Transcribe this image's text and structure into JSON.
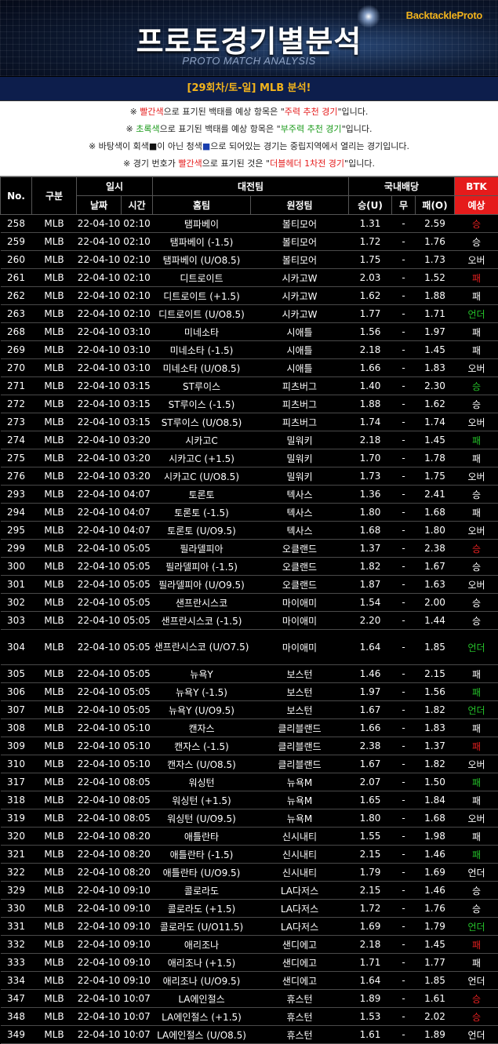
{
  "banner": {
    "brand": "BacktackleProto",
    "title": "프로토경기별분석",
    "subtitle": "PROTO MATCH ANALYSIS"
  },
  "round_title": "[29회차/토-일] MLB 분석!",
  "notes": [
    {
      "segments": [
        [
          "※ ",
          ""
        ],
        [
          "빨간색",
          "red"
        ],
        [
          "으로 표기된 백태를 예상 항목은 \"",
          ""
        ],
        [
          "주력 추천 경기",
          "red"
        ],
        [
          "\"입니다.",
          ""
        ]
      ]
    },
    {
      "segments": [
        [
          "※ ",
          ""
        ],
        [
          "초록색",
          "green"
        ],
        [
          "으로 표기된 백태를 예상 항목은 \"",
          ""
        ],
        [
          "부주력 추천 경기",
          "green"
        ],
        [
          "\"입니다.",
          ""
        ]
      ]
    },
    {
      "segments": [
        [
          "※ 바탕색이 회색",
          ""
        ],
        [
          "■",
          "sq"
        ],
        [
          "이 아닌 청색",
          ""
        ],
        [
          "■",
          "bsq"
        ],
        [
          "으로 되어있는 경기는 중립지역에서 열리는 경기입니다.",
          ""
        ]
      ]
    },
    {
      "segments": [
        [
          "※ 경기 번호가 ",
          ""
        ],
        [
          "빨간색",
          "red"
        ],
        [
          "으로 표기된 것은 \"",
          ""
        ],
        [
          "더블헤더 1차전 경기",
          "red"
        ],
        [
          "\"입니다.",
          ""
        ]
      ]
    }
  ],
  "headers": {
    "no": "No.",
    "category": "구분",
    "datetime": "일시",
    "date": "날짜",
    "time": "시간",
    "match": "대전팀",
    "home": "홈팀",
    "away": "원정팀",
    "odds": "국내배당",
    "win": "승(U)",
    "draw": "무",
    "lose": "패(O)",
    "btk": "BTK",
    "pred": "예상"
  },
  "colors": {
    "red": "#e52020",
    "green": "#25c22a",
    "btk_header": "#e51b1b",
    "title_gold": "#f2b31c"
  },
  "rows": [
    {
      "no": "258",
      "cat": "MLB",
      "date": "22-04-10",
      "time": "02:10",
      "home": "탬파베이",
      "away": "볼티모어",
      "win": "1.31",
      "draw": "-",
      "lose": "2.59",
      "pred": "승",
      "color": "red"
    },
    {
      "no": "259",
      "cat": "MLB",
      "date": "22-04-10",
      "time": "02:10",
      "home": "탬파베이 (-1.5)",
      "away": "볼티모어",
      "win": "1.72",
      "draw": "-",
      "lose": "1.76",
      "pred": "승",
      "color": ""
    },
    {
      "no": "260",
      "cat": "MLB",
      "date": "22-04-10",
      "time": "02:10",
      "home": "탬파베이 (U/O8.5)",
      "away": "볼티모어",
      "win": "1.75",
      "draw": "-",
      "lose": "1.73",
      "pred": "오버",
      "color": ""
    },
    {
      "no": "261",
      "cat": "MLB",
      "date": "22-04-10",
      "time": "02:10",
      "home": "디트로이트",
      "away": "시카고W",
      "win": "2.03",
      "draw": "-",
      "lose": "1.52",
      "pred": "패",
      "color": "red"
    },
    {
      "no": "262",
      "cat": "MLB",
      "date": "22-04-10",
      "time": "02:10",
      "home": "디트로이트 (+1.5)",
      "away": "시카고W",
      "win": "1.62",
      "draw": "-",
      "lose": "1.88",
      "pred": "패",
      "color": ""
    },
    {
      "no": "263",
      "cat": "MLB",
      "date": "22-04-10",
      "time": "02:10",
      "home": "디트로이트 (U/O8.5)",
      "away": "시카고W",
      "win": "1.77",
      "draw": "-",
      "lose": "1.71",
      "pred": "언더",
      "color": "green"
    },
    {
      "no": "268",
      "cat": "MLB",
      "date": "22-04-10",
      "time": "03:10",
      "home": "미네소타",
      "away": "시애틀",
      "win": "1.56",
      "draw": "-",
      "lose": "1.97",
      "pred": "패",
      "color": ""
    },
    {
      "no": "269",
      "cat": "MLB",
      "date": "22-04-10",
      "time": "03:10",
      "home": "미네소타 (-1.5)",
      "away": "시애틀",
      "win": "2.18",
      "draw": "-",
      "lose": "1.45",
      "pred": "패",
      "color": ""
    },
    {
      "no": "270",
      "cat": "MLB",
      "date": "22-04-10",
      "time": "03:10",
      "home": "미네소타 (U/O8.5)",
      "away": "시애틀",
      "win": "1.66",
      "draw": "-",
      "lose": "1.83",
      "pred": "오버",
      "color": ""
    },
    {
      "no": "271",
      "cat": "MLB",
      "date": "22-04-10",
      "time": "03:15",
      "home": "ST루이스",
      "away": "피츠버그",
      "win": "1.40",
      "draw": "-",
      "lose": "2.30",
      "pred": "승",
      "color": "green"
    },
    {
      "no": "272",
      "cat": "MLB",
      "date": "22-04-10",
      "time": "03:15",
      "home": "ST루이스 (-1.5)",
      "away": "피츠버그",
      "win": "1.88",
      "draw": "-",
      "lose": "1.62",
      "pred": "승",
      "color": ""
    },
    {
      "no": "273",
      "cat": "MLB",
      "date": "22-04-10",
      "time": "03:15",
      "home": "ST루이스 (U/O8.5)",
      "away": "피츠버그",
      "win": "1.74",
      "draw": "-",
      "lose": "1.74",
      "pred": "오버",
      "color": ""
    },
    {
      "no": "274",
      "cat": "MLB",
      "date": "22-04-10",
      "time": "03:20",
      "home": "시카고C",
      "away": "밀워키",
      "win": "2.18",
      "draw": "-",
      "lose": "1.45",
      "pred": "패",
      "color": "green"
    },
    {
      "no": "275",
      "cat": "MLB",
      "date": "22-04-10",
      "time": "03:20",
      "home": "시카고C (+1.5)",
      "away": "밀워키",
      "win": "1.70",
      "draw": "-",
      "lose": "1.78",
      "pred": "패",
      "color": ""
    },
    {
      "no": "276",
      "cat": "MLB",
      "date": "22-04-10",
      "time": "03:20",
      "home": "시카고C (U/O8.5)",
      "away": "밀워키",
      "win": "1.73",
      "draw": "-",
      "lose": "1.75",
      "pred": "오버",
      "color": ""
    },
    {
      "no": "293",
      "cat": "MLB",
      "date": "22-04-10",
      "time": "04:07",
      "home": "토론토",
      "away": "텍사스",
      "win": "1.36",
      "draw": "-",
      "lose": "2.41",
      "pred": "승",
      "color": ""
    },
    {
      "no": "294",
      "cat": "MLB",
      "date": "22-04-10",
      "time": "04:07",
      "home": "토론토 (-1.5)",
      "away": "텍사스",
      "win": "1.80",
      "draw": "-",
      "lose": "1.68",
      "pred": "패",
      "color": ""
    },
    {
      "no": "295",
      "cat": "MLB",
      "date": "22-04-10",
      "time": "04:07",
      "home": "토론토 (U/O9.5)",
      "away": "텍사스",
      "win": "1.68",
      "draw": "-",
      "lose": "1.80",
      "pred": "오버",
      "color": ""
    },
    {
      "no": "299",
      "cat": "MLB",
      "date": "22-04-10",
      "time": "05:05",
      "home": "필라델피아",
      "away": "오클랜드",
      "win": "1.37",
      "draw": "-",
      "lose": "2.38",
      "pred": "승",
      "color": "red"
    },
    {
      "no": "300",
      "cat": "MLB",
      "date": "22-04-10",
      "time": "05:05",
      "home": "필라델피아 (-1.5)",
      "away": "오클랜드",
      "win": "1.82",
      "draw": "-",
      "lose": "1.67",
      "pred": "승",
      "color": ""
    },
    {
      "no": "301",
      "cat": "MLB",
      "date": "22-04-10",
      "time": "05:05",
      "home": "필라델피아 (U/O9.5)",
      "away": "오클랜드",
      "win": "1.87",
      "draw": "-",
      "lose": "1.63",
      "pred": "오버",
      "color": ""
    },
    {
      "no": "302",
      "cat": "MLB",
      "date": "22-04-10",
      "time": "05:05",
      "home": "샌프란시스코",
      "away": "마이애미",
      "win": "1.54",
      "draw": "-",
      "lose": "2.00",
      "pred": "승",
      "color": ""
    },
    {
      "no": "303",
      "cat": "MLB",
      "date": "22-04-10",
      "time": "05:05",
      "home": "샌프란시스코 (-1.5)",
      "away": "마이애미",
      "win": "2.20",
      "draw": "-",
      "lose": "1.44",
      "pred": "승",
      "color": ""
    },
    {
      "no": "304",
      "cat": "MLB",
      "date": "22-04-10",
      "time": "05:05",
      "home": "샌프란시스코 (U/O7.5)",
      "away": "마이애미",
      "win": "1.64",
      "draw": "-",
      "lose": "1.85",
      "pred": "언더",
      "color": "green",
      "tall": true
    },
    {
      "no": "305",
      "cat": "MLB",
      "date": "22-04-10",
      "time": "05:05",
      "home": "뉴욕Y",
      "away": "보스턴",
      "win": "1.46",
      "draw": "-",
      "lose": "2.15",
      "pred": "패",
      "color": ""
    },
    {
      "no": "306",
      "cat": "MLB",
      "date": "22-04-10",
      "time": "05:05",
      "home": "뉴욕Y (-1.5)",
      "away": "보스턴",
      "win": "1.97",
      "draw": "-",
      "lose": "1.56",
      "pred": "패",
      "color": "green"
    },
    {
      "no": "307",
      "cat": "MLB",
      "date": "22-04-10",
      "time": "05:05",
      "home": "뉴욕Y (U/O9.5)",
      "away": "보스턴",
      "win": "1.67",
      "draw": "-",
      "lose": "1.82",
      "pred": "언더",
      "color": "green"
    },
    {
      "no": "308",
      "cat": "MLB",
      "date": "22-04-10",
      "time": "05:10",
      "home": "캔자스",
      "away": "클리블랜드",
      "win": "1.66",
      "draw": "-",
      "lose": "1.83",
      "pred": "패",
      "color": ""
    },
    {
      "no": "309",
      "cat": "MLB",
      "date": "22-04-10",
      "time": "05:10",
      "home": "캔자스 (-1.5)",
      "away": "클리블랜드",
      "win": "2.38",
      "draw": "-",
      "lose": "1.37",
      "pred": "패",
      "color": "red"
    },
    {
      "no": "310",
      "cat": "MLB",
      "date": "22-04-10",
      "time": "05:10",
      "home": "캔자스 (U/O8.5)",
      "away": "클리블랜드",
      "win": "1.67",
      "draw": "-",
      "lose": "1.82",
      "pred": "오버",
      "color": ""
    },
    {
      "no": "317",
      "cat": "MLB",
      "date": "22-04-10",
      "time": "08:05",
      "home": "워싱턴",
      "away": "뉴욕M",
      "win": "2.07",
      "draw": "-",
      "lose": "1.50",
      "pred": "패",
      "color": "green"
    },
    {
      "no": "318",
      "cat": "MLB",
      "date": "22-04-10",
      "time": "08:05",
      "home": "워싱턴 (+1.5)",
      "away": "뉴욕M",
      "win": "1.65",
      "draw": "-",
      "lose": "1.84",
      "pred": "패",
      "color": ""
    },
    {
      "no": "319",
      "cat": "MLB",
      "date": "22-04-10",
      "time": "08:05",
      "home": "워싱턴 (U/O9.5)",
      "away": "뉴욕M",
      "win": "1.80",
      "draw": "-",
      "lose": "1.68",
      "pred": "오버",
      "color": ""
    },
    {
      "no": "320",
      "cat": "MLB",
      "date": "22-04-10",
      "time": "08:20",
      "home": "애틀란타",
      "away": "신시내티",
      "win": "1.55",
      "draw": "-",
      "lose": "1.98",
      "pred": "패",
      "color": ""
    },
    {
      "no": "321",
      "cat": "MLB",
      "date": "22-04-10",
      "time": "08:20",
      "home": "애틀란타 (-1.5)",
      "away": "신시내티",
      "win": "2.15",
      "draw": "-",
      "lose": "1.46",
      "pred": "패",
      "color": "green"
    },
    {
      "no": "322",
      "cat": "MLB",
      "date": "22-04-10",
      "time": "08:20",
      "home": "애틀란타 (U/O9.5)",
      "away": "신시내티",
      "win": "1.79",
      "draw": "-",
      "lose": "1.69",
      "pred": "언더",
      "color": ""
    },
    {
      "no": "329",
      "cat": "MLB",
      "date": "22-04-10",
      "time": "09:10",
      "home": "콜로라도",
      "away": "LA다저스",
      "win": "2.15",
      "draw": "-",
      "lose": "1.46",
      "pred": "승",
      "color": ""
    },
    {
      "no": "330",
      "cat": "MLB",
      "date": "22-04-10",
      "time": "09:10",
      "home": "콜로라도 (+1.5)",
      "away": "LA다저스",
      "win": "1.72",
      "draw": "-",
      "lose": "1.76",
      "pred": "승",
      "color": ""
    },
    {
      "no": "331",
      "cat": "MLB",
      "date": "22-04-10",
      "time": "09:10",
      "home": "콜로라도 (U/O11.5)",
      "away": "LA다저스",
      "win": "1.69",
      "draw": "-",
      "lose": "1.79",
      "pred": "언더",
      "color": "green"
    },
    {
      "no": "332",
      "cat": "MLB",
      "date": "22-04-10",
      "time": "09:10",
      "home": "애리조나",
      "away": "샌디에고",
      "win": "2.18",
      "draw": "-",
      "lose": "1.45",
      "pred": "패",
      "color": "red"
    },
    {
      "no": "333",
      "cat": "MLB",
      "date": "22-04-10",
      "time": "09:10",
      "home": "애리조나 (+1.5)",
      "away": "샌디에고",
      "win": "1.71",
      "draw": "-",
      "lose": "1.77",
      "pred": "패",
      "color": ""
    },
    {
      "no": "334",
      "cat": "MLB",
      "date": "22-04-10",
      "time": "09:10",
      "home": "애리조나 (U/O9.5)",
      "away": "샌디에고",
      "win": "1.64",
      "draw": "-",
      "lose": "1.85",
      "pred": "언더",
      "color": ""
    },
    {
      "no": "347",
      "cat": "MLB",
      "date": "22-04-10",
      "time": "10:07",
      "home": "LA에인절스",
      "away": "휴스턴",
      "win": "1.89",
      "draw": "-",
      "lose": "1.61",
      "pred": "승",
      "color": "red"
    },
    {
      "no": "348",
      "cat": "MLB",
      "date": "22-04-10",
      "time": "10:07",
      "home": "LA에인절스 (+1.5)",
      "away": "휴스턴",
      "win": "1.53",
      "draw": "-",
      "lose": "2.02",
      "pred": "승",
      "color": "red"
    },
    {
      "no": "349",
      "cat": "MLB",
      "date": "22-04-10",
      "time": "10:07",
      "home": "LA에인절스 (U/O8.5)",
      "away": "휴스턴",
      "win": "1.61",
      "draw": "-",
      "lose": "1.89",
      "pred": "언더",
      "color": ""
    }
  ]
}
